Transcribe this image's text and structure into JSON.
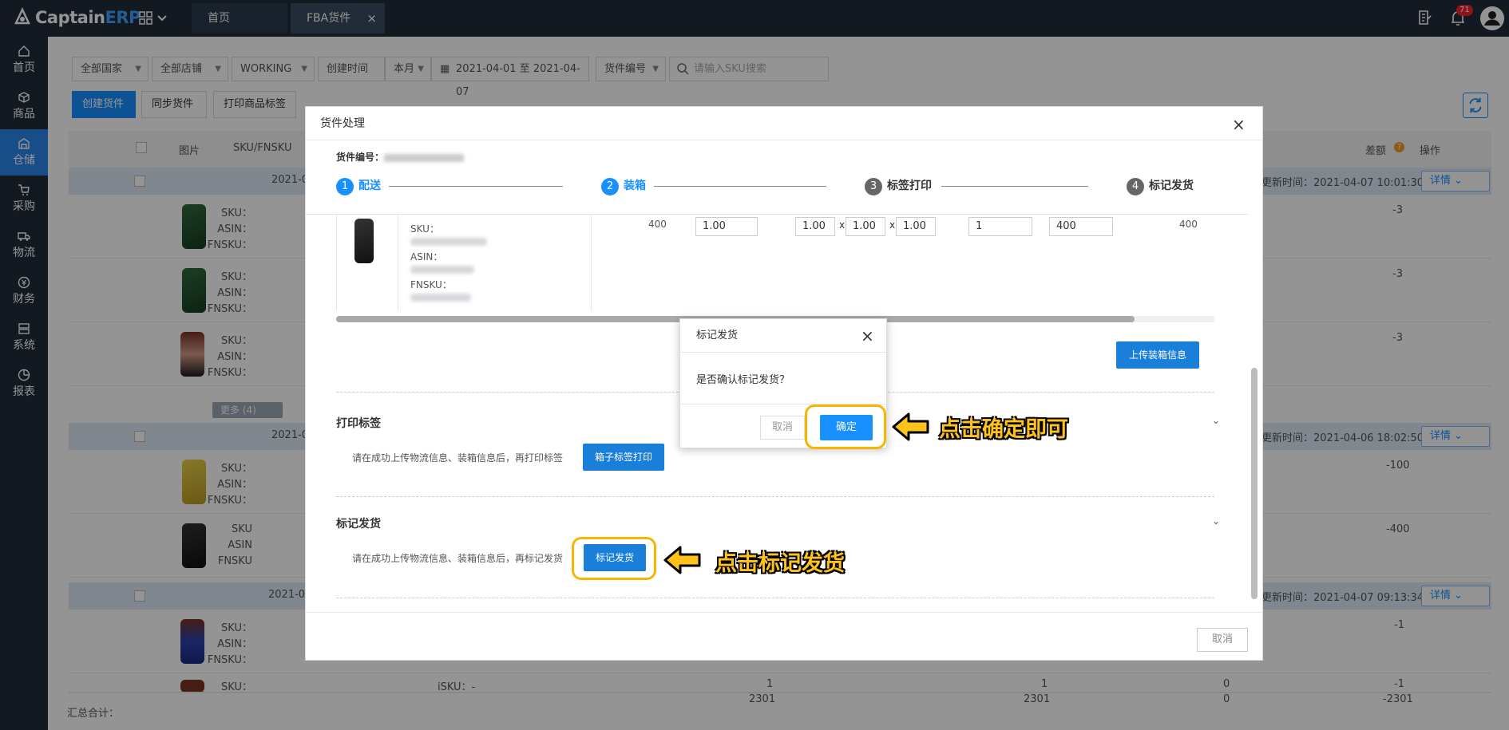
{
  "app": {
    "logo_captain": "Captain",
    "logo_erp": "ERP"
  },
  "tabs": [
    {
      "label": "首页"
    },
    {
      "label": "FBA货件",
      "close": "×"
    }
  ],
  "notifications": {
    "count": "71"
  },
  "sidebar": {
    "items": [
      {
        "label": "首页",
        "icon": "home-icon"
      },
      {
        "label": "商品",
        "icon": "box-icon"
      },
      {
        "label": "仓储",
        "icon": "warehouse-icon",
        "active": true
      },
      {
        "label": "采购",
        "icon": "cart-icon"
      },
      {
        "label": "物流",
        "icon": "truck-icon"
      },
      {
        "label": "财务",
        "icon": "money-icon"
      },
      {
        "label": "系统",
        "icon": "server-icon"
      },
      {
        "label": "报表",
        "icon": "chart-icon"
      }
    ]
  },
  "filters": {
    "country": "全部国家",
    "shop": "全部店铺",
    "status": "WORKING",
    "time_type": "创建时间",
    "period": "本月",
    "date_range": "2021-04-01 至 2021-04-07",
    "search_type": "货件编号",
    "search_placeholder": "请输入SKU搜索"
  },
  "toolbar": {
    "create": "创建货件",
    "sync": "同步货件",
    "print": "打印商品标签"
  },
  "table": {
    "headers": {
      "image": "图片",
      "sku": "SKU/FNSKU",
      "diff": "差额",
      "action": "操作"
    },
    "groups": [
      {
        "date_frag": "2021-04-",
        "updated": "更新时间：2021-04-07 10:01:30",
        "detail": "详情"
      },
      {
        "date_frag": "2021-04-",
        "updated": "更新时间：2021-04-06 18:02:50",
        "detail": "详情"
      },
      {
        "date_frag": "2021-04",
        "updated": "更新时间：2021-04-07 09:13:34",
        "detail": "详情"
      }
    ],
    "row_labels": {
      "sku": "SKU：",
      "asin": "ASIN：",
      "fnsku": "FNSKU：",
      "sku_plain": "SKU",
      "asin_plain": "ASIN",
      "fnsku_plain": "FNSKU"
    },
    "diffs": [
      "-3",
      "-3",
      "-3",
      "-100",
      "-400",
      "-1",
      "-1"
    ],
    "more": "更多 (4)",
    "last_row": {
      "sku_label": "iSKU：-",
      "c1": "1",
      "c2": "1",
      "c3": "0"
    },
    "footer": {
      "label": "汇总合计：",
      "c1": "2301",
      "c2": "2301",
      "c3": "0",
      "c4": "-2301"
    }
  },
  "modal": {
    "title": "货件处理",
    "close": "×",
    "shipment_label": "货件编号：",
    "steps": [
      {
        "num": "1",
        "label": "配送"
      },
      {
        "num": "2",
        "label": "装箱"
      },
      {
        "num": "3",
        "label": "标签打印"
      },
      {
        "num": "4",
        "label": "标记发货"
      }
    ],
    "pack_row": {
      "sku": "SKU：",
      "asin": "ASIN：",
      "fnsku": "FNSKU：",
      "qty": "400",
      "weight": "1.00",
      "dim1": "1.00",
      "dim2": "1.00",
      "dim3": "1.00",
      "times": "x",
      "boxes": "1",
      "total": "400",
      "packed": "400"
    },
    "upload_btn": "上传装箱信息",
    "print_section": {
      "title": "打印标签",
      "hint": "请在成功上传物流信息、装箱信息后，再打印标签",
      "btn": "箱子标签打印"
    },
    "ship_section": {
      "title": "标记发货",
      "hint": "请在成功上传物流信息、装箱信息后，再标记发货",
      "btn": "标记发货"
    },
    "cancel": "取消"
  },
  "confirm": {
    "title": "标记发货",
    "close": "×",
    "message": "是否确认标记发货？",
    "cancel": "取消",
    "ok": "确定"
  },
  "annotations": {
    "ok_hint": "点击确定即可",
    "ship_hint": "点击标记发货"
  }
}
